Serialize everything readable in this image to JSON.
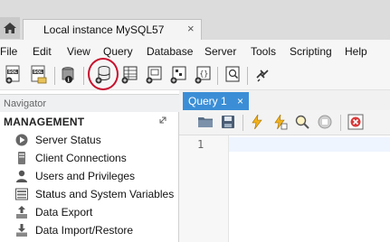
{
  "tabs": {
    "home_icon": "home-icon",
    "connection_tab": {
      "label": "Local instance MySQL57",
      "close": "×"
    }
  },
  "menu": [
    "File",
    "Edit",
    "View",
    "Query",
    "Database",
    "Server",
    "Tools",
    "Scripting",
    "Help"
  ],
  "toolbar": {
    "icons": [
      "new-sql-tab-icon",
      "open-sql-script-icon",
      "inspector-icon",
      "create-schema-icon",
      "create-table-icon",
      "create-view-icon",
      "create-procedure-icon",
      "create-function-icon",
      "search-table-data-icon",
      "reconnect-icon"
    ],
    "highlight_color": "#c8102e"
  },
  "navigator": {
    "title": "Navigator",
    "section": "MANAGEMENT",
    "items": [
      {
        "label": "Server Status",
        "icon": "server-status-icon"
      },
      {
        "label": "Client Connections",
        "icon": "client-connections-icon"
      },
      {
        "label": "Users and Privileges",
        "icon": "users-icon"
      },
      {
        "label": "Status and System Variables",
        "icon": "variables-icon"
      },
      {
        "label": "Data Export",
        "icon": "data-export-icon"
      },
      {
        "label": "Data Import/Restore",
        "icon": "data-import-icon"
      }
    ]
  },
  "editor": {
    "tab": {
      "label": "Query 1",
      "close": "×"
    },
    "line_number": "1",
    "icons": [
      "open-file-icon",
      "save-icon",
      "execute-icon",
      "execute-current-icon",
      "explain-icon",
      "stop-icon",
      "toggle-error-icon"
    ]
  },
  "colors": {
    "accent": "#3b8ed6",
    "tab_bg": "#dcdcdc",
    "highlight": "#c8102e"
  }
}
